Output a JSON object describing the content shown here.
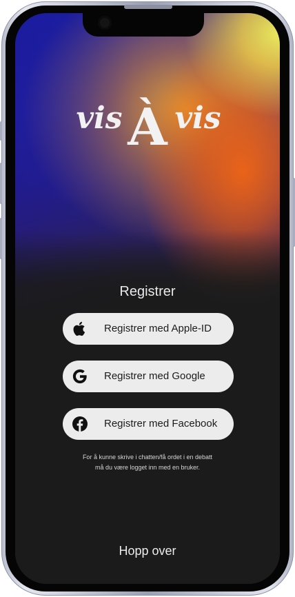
{
  "logo": {
    "text": "vis À vis",
    "word_left": "vis",
    "letter_center": "À",
    "word_right": "vis"
  },
  "register": {
    "title": "Registrer",
    "buttons": [
      {
        "label": "Registrer med Apple-ID",
        "icon": "apple-icon"
      },
      {
        "label": "Registrer med Google",
        "icon": "google-icon"
      },
      {
        "label": "Registrer med Facebook",
        "icon": "facebook-icon"
      }
    ],
    "note_line1": "For å kunne skrive i chatten/få ordet i en debatt",
    "note_line2": "må du være logget inn med en bruker."
  },
  "skip": {
    "label": "Hopp over"
  },
  "colors": {
    "background": "#1b1b1b",
    "button_bg": "#ececec",
    "button_text": "#1b1b1b",
    "gradient_blue": "#1a1fa0",
    "gradient_orange": "#f0641e",
    "gradient_yellow": "#f4f45a"
  }
}
